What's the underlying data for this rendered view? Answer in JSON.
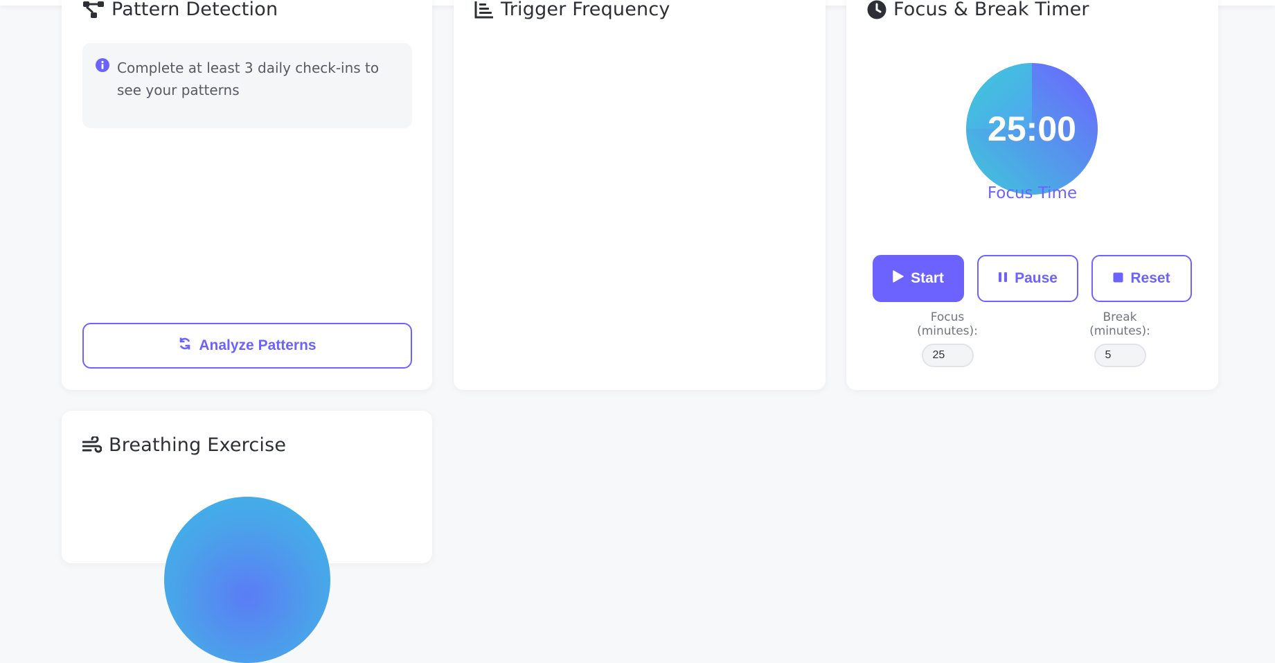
{
  "pattern_card": {
    "title": "Pattern Detection",
    "info_text": "Complete at least 3 daily check-ins to see your patterns",
    "analyze_label": "Analyze Patterns"
  },
  "trigger_card": {
    "title": "Trigger Frequency"
  },
  "timer_card": {
    "title": "Focus & Break Timer",
    "time_display": "25:00",
    "mode_label": "Focus Time",
    "progress_fraction": 0.0,
    "start_label": "Start",
    "pause_label": "Pause",
    "reset_label": "Reset",
    "focus_label": "Focus (minutes):",
    "focus_value": "25",
    "break_label": "Break (minutes):",
    "break_value": "5"
  },
  "breathing_card": {
    "title": "Breathing Exercise"
  },
  "colors": {
    "accent": "#6c63ff",
    "timer_gradient_start": "#6c63ff",
    "timer_gradient_end": "#3ec9da",
    "background": "#f7f8fa"
  },
  "icons": {
    "pattern": "network-icon",
    "trigger": "bar-chart-icon",
    "timer": "clock-icon",
    "breathing": "wind-icon",
    "info": "info-circle-icon",
    "analyze": "refresh-icon",
    "start": "play-icon",
    "pause": "pause-icon",
    "reset": "stop-icon"
  }
}
